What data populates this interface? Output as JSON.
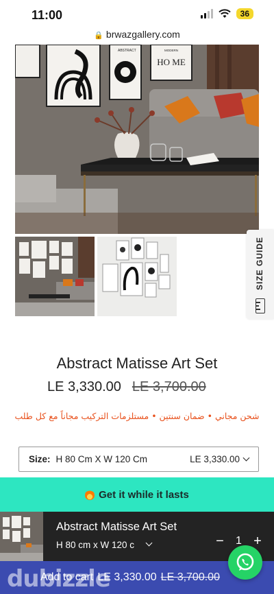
{
  "status_bar": {
    "time": "11:00",
    "battery": "36"
  },
  "browser": {
    "url": "brwazgallery.com"
  },
  "gallery": {
    "size_guide_label": "SIZE GUIDE",
    "hero_poster_text": "HO ME",
    "hero_poster_small": "MODERN",
    "hero_poster_abstract": "ABSTRACT"
  },
  "product": {
    "title": "Abstract Matisse Art Set",
    "price": "LE 3,330.00",
    "compare_price": "LE 3,700.00",
    "promo": "شحن مجاني • ضمان سنتين • مستلزمات التركيب مجاناً مع كل طلب"
  },
  "size_selector": {
    "label": "Size:",
    "value": "H 80 Cm X W 120 Cm",
    "price": "LE 3,330.00"
  },
  "urgency": {
    "text": "Get it while it lasts"
  },
  "sticky_cart": {
    "title": "Abstract Matisse Art Set",
    "variant": "H 80 cm x W 120 c",
    "minus": "−",
    "quantity": "1",
    "plus": "+"
  },
  "add_to_cart": {
    "label": "Add to cart",
    "price": "LE 3,330.00",
    "compare_price": "LE 3,700.00"
  },
  "watermark": "dubizzle",
  "colors": {
    "accent_teal": "#2de6c1",
    "cart_blue": "#3b4bb0",
    "promo_orange": "#e8501b",
    "sticky_dark": "#232323",
    "whatsapp_green": "#25d366"
  }
}
